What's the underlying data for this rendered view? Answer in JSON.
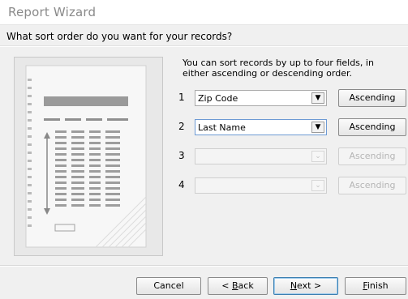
{
  "window": {
    "title": "Report Wizard"
  },
  "heading": "What sort order do you want for your records?",
  "description": "You can sort records by up to four fields, in either ascending or descending order.",
  "sort_rows": [
    {
      "number": "1",
      "field": "Zip Code",
      "order": "Ascending",
      "enabled": true
    },
    {
      "number": "2",
      "field": "Last Name",
      "order": "Ascending",
      "enabled": true
    },
    {
      "number": "3",
      "field": "",
      "order": "Ascending",
      "enabled": false
    },
    {
      "number": "4",
      "field": "",
      "order": "Ascending",
      "enabled": false
    }
  ],
  "buttons": {
    "cancel": "Cancel",
    "back_prefix": "< ",
    "back_key": "B",
    "back_rest": "ack",
    "next_key": "N",
    "next_rest": "ext >",
    "finish_key": "F",
    "finish_rest": "inish"
  },
  "icons": {
    "dropdown": "chevron-down-icon",
    "preview": "report-preview-image"
  }
}
